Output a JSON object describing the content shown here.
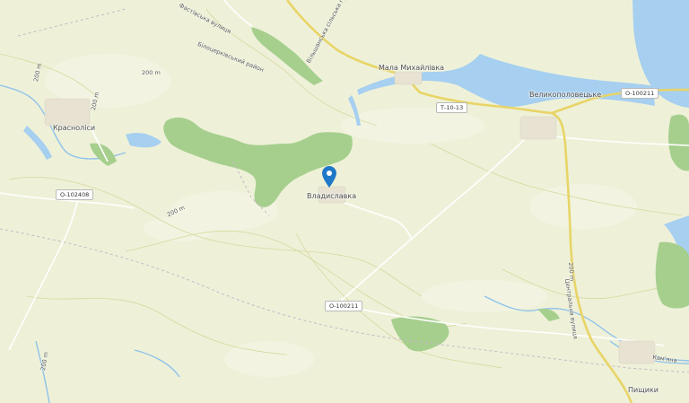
{
  "places": {
    "krasnolisy": "Красноліси",
    "mala_mykhailivka": "Мала Михайлівка",
    "velykopolovetske": "Великополовецьке",
    "vladyslavka": "Владиславка",
    "pyshchyky": "Пищики"
  },
  "roads": {
    "o102408": "О-102408",
    "t1013": "Т-10-13",
    "o100211_top": "О-100211",
    "o100211_mid": "О-100211"
  },
  "street_labels": {
    "fastivska": "Фастівська вулиця",
    "bilotserkivskyi": "Білоцерківський район",
    "vilshanska": "Вільшанська сільська громада",
    "tsentralna": "Центральна вулиця",
    "kamiana": "Кам'яна"
  },
  "contours": [
    "200 m",
    "200 m",
    "200 m",
    "200 m",
    "200 m",
    "200 m"
  ],
  "marker": {
    "icon": "map-pin-icon",
    "color": "#1f78c8"
  },
  "colors": {
    "land": "#eef1d8",
    "water": "#a6cff0",
    "forest": "#a6cf8e",
    "road_major": "#f1e27d",
    "road_minor": "#ffffff"
  }
}
